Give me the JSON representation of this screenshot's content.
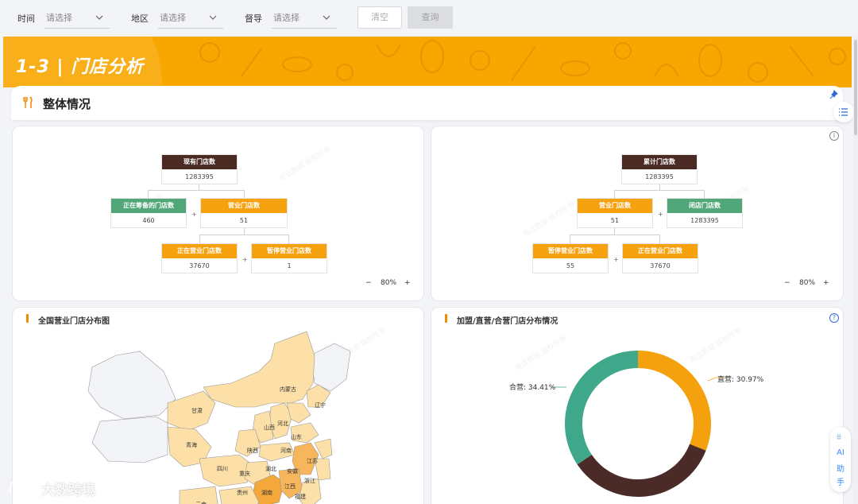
{
  "filters": [
    {
      "label": "时间",
      "placeholder": "请选择"
    },
    {
      "label": "地区",
      "placeholder": "请选择"
    },
    {
      "label": "督导",
      "placeholder": "请选择"
    }
  ],
  "buttons": {
    "clear": "清空",
    "query": "查询"
  },
  "banner": {
    "title": "1-3 | 门店分析"
  },
  "section": {
    "title": "整体情况"
  },
  "tree_left": {
    "root": {
      "label": "现有门店数",
      "value": "1283395"
    },
    "preparing": {
      "label": "正在筹备的门店数",
      "value": "460"
    },
    "business": {
      "label": "营业门店数",
      "value": "51"
    },
    "operating": {
      "label": "正在营业门店数",
      "value": "37670"
    },
    "paused": {
      "label": "暂停营业门店数",
      "value": "1"
    },
    "plus": "+",
    "zoom": "80%"
  },
  "tree_right": {
    "root": {
      "label": "累计门店数",
      "value": "1283395"
    },
    "business": {
      "label": "营业门店数",
      "value": "51"
    },
    "closed": {
      "label": "闭店门店数",
      "value": "1283395"
    },
    "paused": {
      "label": "暂停营业门店数",
      "value": "55"
    },
    "operating": {
      "label": "正在营业门店数",
      "value": "37670"
    },
    "plus": "+",
    "zoom": "80%"
  },
  "zoom_controls": {
    "minus": "−",
    "plus": "+"
  },
  "map_card": {
    "title": "全国营业门店分布图",
    "provinces": [
      "内蒙古",
      "辽宁",
      "甘肃",
      "河北",
      "山西",
      "青海",
      "山东",
      "陕西",
      "河南",
      "江苏",
      "四川",
      "湖北",
      "安徽",
      "重庆",
      "浙江",
      "湖南",
      "江西",
      "福建",
      "贵州",
      "云南"
    ]
  },
  "donut_card": {
    "title": "加盟/直营/合营门店分布情况",
    "labels": {
      "direct": "直营: 30.97%",
      "joint": "合营: 34.41%"
    }
  },
  "chart_data": {
    "type": "pie",
    "title": "加盟/直营/合营门店分布情况",
    "slices": [
      {
        "name": "直营",
        "value": 30.97,
        "color": "#f5a10e"
      },
      {
        "name": "加盟",
        "value": 34.62,
        "color": "#4b2b27"
      },
      {
        "name": "合营",
        "value": 34.41,
        "color": "#40a88a"
      }
    ]
  },
  "ai_assistant": {
    "line1": "AI",
    "line2": "助",
    "line3": "手"
  },
  "watermark": {
    "text": "观远数据 版权所有"
  },
  "logo": {
    "text": "大数跨境"
  },
  "icons": {
    "filter_chevron": "chevron-down-icon",
    "section": "fork-knife-icon",
    "pin": "pin-icon",
    "list": "list-icon",
    "info": "info-icon",
    "help": "help-icon"
  },
  "colors": {
    "accent": "#f8a600",
    "dark": "#4a2a22",
    "green": "#52a77a"
  }
}
